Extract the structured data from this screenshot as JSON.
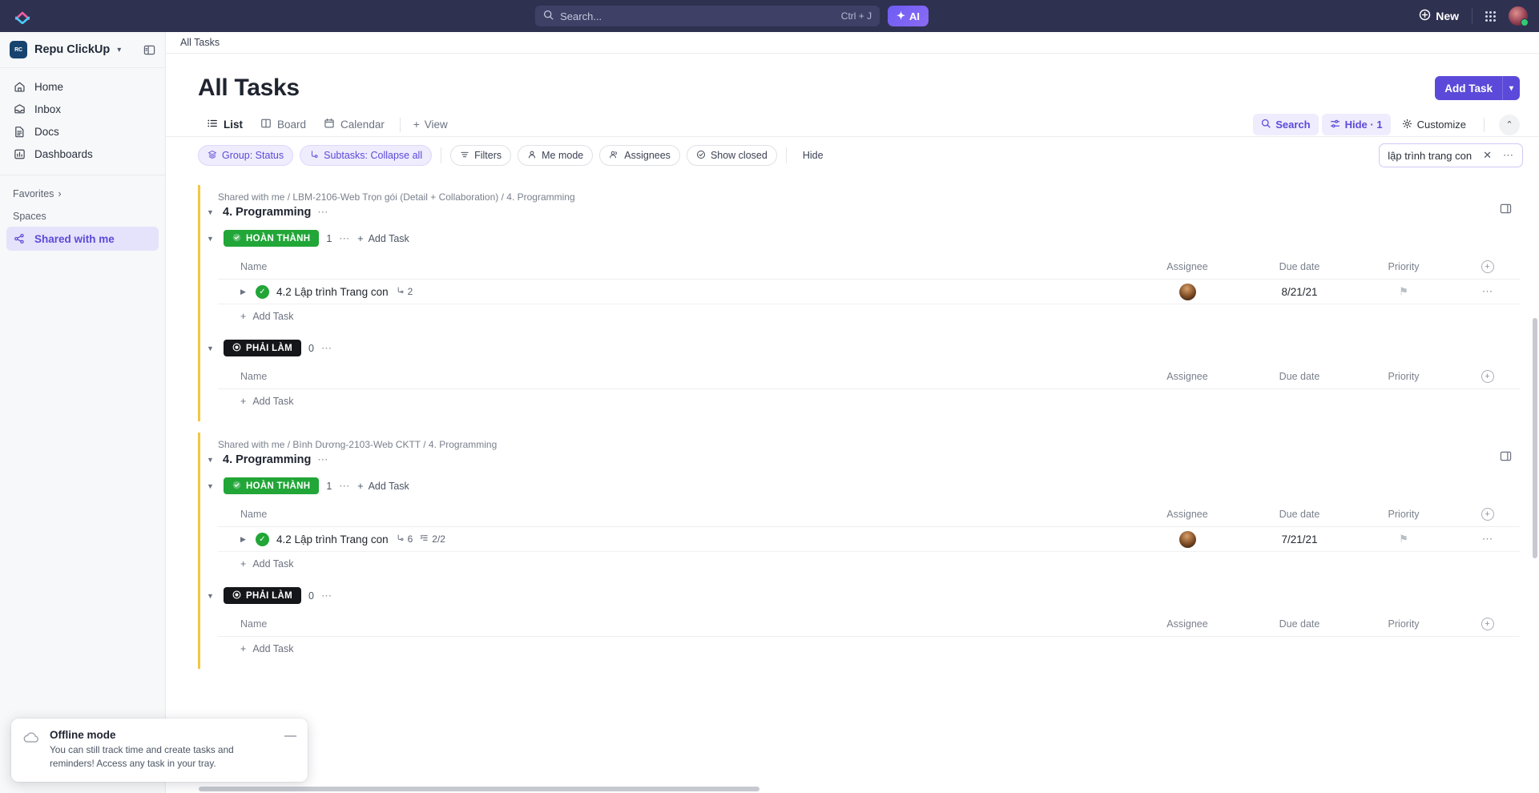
{
  "topbar": {
    "search_placeholder": "Search...",
    "search_shortcut": "Ctrl + J",
    "ai_label": "AI",
    "new_label": "New"
  },
  "sidebar": {
    "workspace": "Repu ClickUp",
    "workspace_initials": "RC",
    "nav": [
      {
        "label": "Home",
        "icon": "home-icon"
      },
      {
        "label": "Inbox",
        "icon": "inbox-icon"
      },
      {
        "label": "Docs",
        "icon": "docs-icon"
      },
      {
        "label": "Dashboards",
        "icon": "dashboards-icon"
      }
    ],
    "favorites_label": "Favorites",
    "spaces_label": "Spaces",
    "space_active": "Shared with me"
  },
  "breadcrumb": "All Tasks",
  "page": {
    "title": "All Tasks",
    "add_task_label": "Add Task"
  },
  "tabs": [
    {
      "label": "List",
      "icon": "list-icon",
      "active": true
    },
    {
      "label": "Board",
      "icon": "board-icon",
      "active": false
    },
    {
      "label": "Calendar",
      "icon": "calendar-icon",
      "active": false
    }
  ],
  "add_view_label": "View",
  "view_controls": {
    "search_label": "Search",
    "hide_label": "Hide · 1",
    "customize_label": "Customize"
  },
  "filters": {
    "group": "Group: Status",
    "subtasks": "Subtasks: Collapse all",
    "filters": "Filters",
    "me_mode": "Me mode",
    "assignees": "Assignees",
    "show_closed": "Show closed",
    "hide": "Hide",
    "search_value": "lập trình trang con"
  },
  "columns": {
    "name": "Name",
    "assignee": "Assignee",
    "due_date": "Due date",
    "priority": "Priority"
  },
  "add_task_inline": "Add Task",
  "groups": [
    {
      "crumb": "Shared with me / LBM-2106-Web Trọn gói (Detail + Collaboration) / 4. Programming",
      "title": "4. Programming",
      "statuses": [
        {
          "label": "HOÀN THÀNH",
          "count": "1",
          "kind": "done",
          "tasks": [
            {
              "name": "4.2 Lập trình Trang con",
              "subtask_count": "2",
              "checklist": "",
              "due_date": "8/21/21"
            }
          ]
        },
        {
          "label": "PHẢI LÀM",
          "count": "0",
          "kind": "todo",
          "tasks": []
        }
      ]
    },
    {
      "crumb": "Shared with me / Bình Dương-2103-Web CKTT / 4. Programming",
      "title": "4. Programming",
      "statuses": [
        {
          "label": "HOÀN THÀNH",
          "count": "1",
          "kind": "done",
          "tasks": [
            {
              "name": "4.2 Lập trình Trang con",
              "subtask_count": "6",
              "checklist": "2/2",
              "due_date": "7/21/21"
            }
          ]
        },
        {
          "label": "PHẢI LÀM",
          "count": "0",
          "kind": "todo",
          "tasks": []
        }
      ]
    }
  ],
  "toast": {
    "title": "Offline mode",
    "body": "You can still track time and create tasks and reminders! Access any task in your tray."
  },
  "colors": {
    "accent": "#5b4ad9",
    "topbar": "#2f3151",
    "status_done": "#21a637",
    "status_todo": "#15161a",
    "group_stripe": "#f2c744"
  }
}
